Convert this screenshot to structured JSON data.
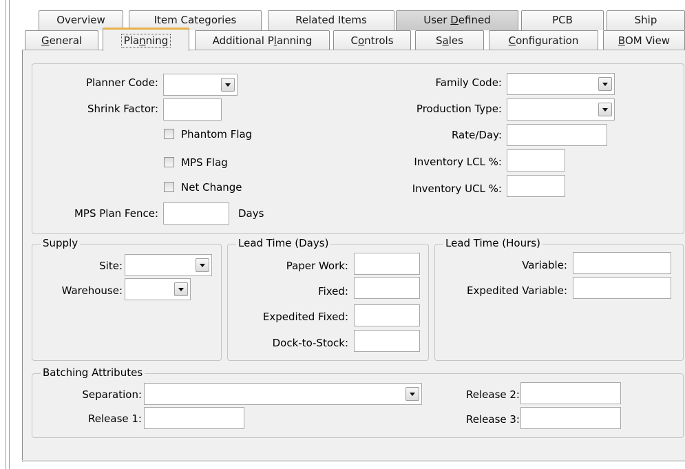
{
  "tabs_top": [
    "Overview",
    "Item Categories",
    "Related Items",
    "User Defined",
    "PCB",
    "Ship"
  ],
  "tabs_bottom": [
    "General",
    "Planning",
    "Additional Planning",
    "Controls",
    "Sales",
    "Configuration",
    "BOM View"
  ],
  "planning": {
    "planner_code": "Planner Code:",
    "shrink_factor": "Shrink Factor:",
    "phantom_flag": "Phantom Flag",
    "mps_flag": "MPS Flag",
    "net_change": "Net Change",
    "mps_plan_fence": "MPS Plan Fence:",
    "days": "Days",
    "family_code": "Family Code:",
    "production_type": "Production Type:",
    "rate_day": "Rate/Day:",
    "inventory_lcl": "Inventory LCL %:",
    "inventory_ucl": "Inventory UCL %:"
  },
  "supply": {
    "title": "Supply",
    "site": "Site:",
    "warehouse": "Warehouse:"
  },
  "lead_days": {
    "title": "Lead Time (Days)",
    "paper_work": "Paper Work:",
    "fixed": "Fixed:",
    "expedited_fixed": "Expedited Fixed:",
    "dock_to_stock": "Dock-to-Stock:"
  },
  "lead_hours": {
    "title": "Lead Time (Hours)",
    "variable": "Variable:",
    "expedited_variable": "Expedited Variable:"
  },
  "batching": {
    "title": "Batching Attributes",
    "separation": "Separation:",
    "release1": "Release 1:",
    "release2": "Release 2:",
    "release3": "Release 3:"
  },
  "colors": {
    "panel": "#f0f0f0",
    "active_tab_accent": "#e7b04a",
    "user_defined_tab": "#cfcfcf"
  },
  "icons": {
    "dropdown": "chevron-down-icon"
  }
}
